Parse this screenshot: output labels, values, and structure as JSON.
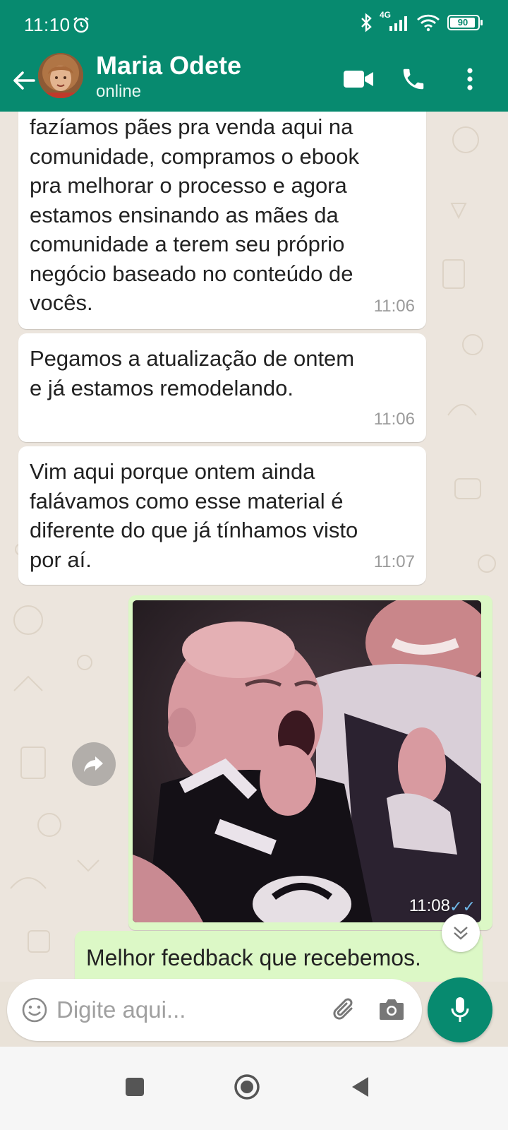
{
  "status_bar": {
    "time": "11:10",
    "network": "4G",
    "battery": "90"
  },
  "header": {
    "contact_name": "Maria Odete",
    "contact_status": "online"
  },
  "messages": [
    {
      "lines": [
        "fazíamos pães pra venda aqui na",
        "comunidade, compramos o ebook",
        "pra melhorar o processo e agora",
        "estamos ensinando as mães da",
        "comunidade a terem seu próprio",
        "negócio baseado no conteúdo de",
        "vocês."
      ],
      "time": "11:06"
    },
    {
      "lines": [
        "Pegamos a atualização de ontem",
        "e já estamos remodelando."
      ],
      "time": "11:06"
    },
    {
      "lines": [
        "Vim aqui porque ontem ainda",
        "falávamos como esse material é",
        "diferente do que já tínhamos visto",
        "por aí."
      ],
      "time": "11:07"
    }
  ],
  "image_message": {
    "time": "11:08",
    "ticks": "✓✓"
  },
  "outgoing_message": {
    "text": "Melhor feedback que recebemos."
  },
  "composer": {
    "placeholder": "Digite aqui..."
  },
  "colors": {
    "header": "#078a6f",
    "incoming_bubble": "#ffffff",
    "outgoing_bubble": "#dcf8c6",
    "read_ticks": "#6fb8e8"
  },
  "icons": [
    "alarm-icon",
    "bluetooth-icon",
    "signal-icon",
    "wifi-icon",
    "battery-icon",
    "back-arrow-icon",
    "video-call-icon",
    "phone-icon",
    "more-vert-icon",
    "forward-icon",
    "scroll-down-icon",
    "emoji-icon",
    "attach-icon",
    "camera-icon",
    "mic-icon",
    "nav-square-icon",
    "nav-home-icon",
    "nav-back-icon"
  ]
}
